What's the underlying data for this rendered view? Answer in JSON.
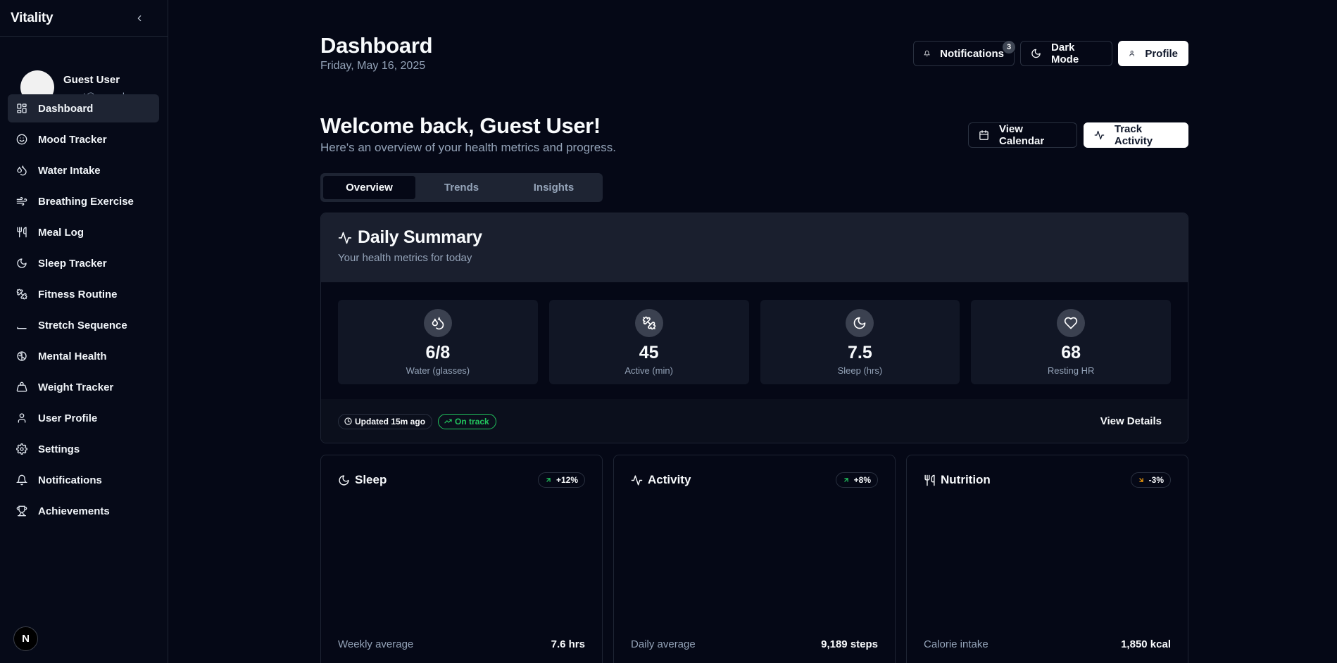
{
  "app": {
    "brand": "Vitality"
  },
  "user": {
    "name": "Guest User",
    "email": "guest@example.com"
  },
  "nav": [
    {
      "label": "Dashboard",
      "icon": "grid-icon",
      "active": true
    },
    {
      "label": "Mood Tracker",
      "icon": "smile-icon"
    },
    {
      "label": "Water Intake",
      "icon": "droplets-icon"
    },
    {
      "label": "Breathing Exercise",
      "icon": "wind-icon"
    },
    {
      "label": "Meal Log",
      "icon": "utensils-icon"
    },
    {
      "label": "Sleep Tracker",
      "icon": "moon-icon"
    },
    {
      "label": "Fitness Routine",
      "icon": "dumbbell-icon"
    },
    {
      "label": "Stretch Sequence",
      "icon": "mat-icon"
    },
    {
      "label": "Mental Health",
      "icon": "brain-icon"
    },
    {
      "label": "Weight Tracker",
      "icon": "weight-icon"
    },
    {
      "label": "User Profile",
      "icon": "user-icon"
    },
    {
      "label": "Settings",
      "icon": "gear-icon"
    },
    {
      "label": "Notifications",
      "icon": "bell-icon"
    },
    {
      "label": "Achievements",
      "icon": "trophy-icon"
    }
  ],
  "footer_badge": "N",
  "header": {
    "title": "Dashboard",
    "date": "Friday, May 16, 2025",
    "notifications_label": "Notifications",
    "notifications_count": "3",
    "dark_mode_label": "Dark Mode",
    "profile_label": "Profile"
  },
  "welcome": {
    "title": "Welcome back, Guest User!",
    "subtitle": "Here's an overview of your health metrics and progress.",
    "view_calendar_label": "View Calendar",
    "track_activity_label": "Track Activity"
  },
  "tabs": [
    {
      "label": "Overview",
      "active": true
    },
    {
      "label": "Trends"
    },
    {
      "label": "Insights"
    }
  ],
  "summary": {
    "title": "Daily Summary",
    "subtitle": "Your health metrics for today",
    "stats": [
      {
        "value": "6/8",
        "label": "Water (glasses)",
        "icon": "droplets-icon"
      },
      {
        "value": "45",
        "label": "Active (min)",
        "icon": "dumbbell-icon"
      },
      {
        "value": "7.5",
        "label": "Sleep (hrs)",
        "icon": "moon-icon"
      },
      {
        "value": "68",
        "label": "Resting HR",
        "icon": "heart-icon"
      }
    ],
    "updated": "Updated 15m ago",
    "status": "On track",
    "view_details": "View Details"
  },
  "metrics": [
    {
      "title": "Sleep",
      "icon": "moon-icon",
      "delta": "+12%",
      "trend": "up",
      "foot_label": "Weekly average",
      "foot_value": "7.6 hrs"
    },
    {
      "title": "Activity",
      "icon": "activity-icon",
      "delta": "+8%",
      "trend": "up",
      "foot_label": "Daily average",
      "foot_value": "9,189 steps"
    },
    {
      "title": "Nutrition",
      "icon": "utensils-icon",
      "delta": "-3%",
      "trend": "down",
      "foot_label": "Calorie intake",
      "foot_value": "1,850 kcal"
    }
  ],
  "colors": {
    "background": "#050816",
    "sidebar_active": "#1e2433",
    "success": "#22c55e",
    "warning": "#f59e0b"
  }
}
